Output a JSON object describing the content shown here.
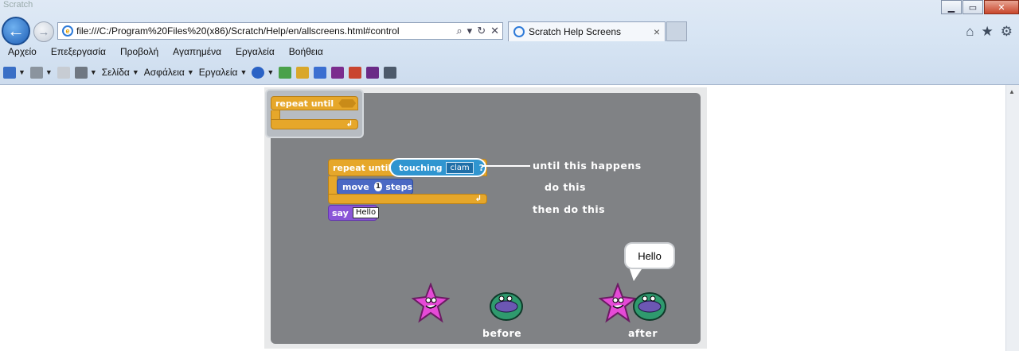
{
  "window": {
    "title_faint": "Scratch",
    "controls": {
      "minimize": "▁",
      "maximize": "▭",
      "close": "✕"
    }
  },
  "address_bar": {
    "url": "file:///C:/Program%20Files%20(x86)/Scratch/Help/en/allscreens.html#control",
    "tools": {
      "search": "⌕",
      "dropdown": "▾",
      "refresh": "↻",
      "stop": "✕"
    }
  },
  "tab": {
    "title": "Scratch Help Screens",
    "close": "×"
  },
  "right_nav": {
    "home": "⌂",
    "favorites": "★",
    "tools": "⚙"
  },
  "menubar": [
    "Αρχείο",
    "Επεξεργασία",
    "Προβολή",
    "Αγαπημένα",
    "Εργαλεία",
    "Βοήθεια"
  ],
  "command_bar": {
    "page": "Σελίδα",
    "safety": "Ασφάλεια",
    "tools": "Εργαλεία"
  },
  "scratch": {
    "palette_block": {
      "label": "repeat until"
    },
    "script": {
      "repeat_label": "repeat until",
      "sensing_label": "touching",
      "sensing_field": "clam",
      "sensing_q": "?",
      "move_label": "move",
      "move_steps": "1",
      "move_unit": "steps",
      "say_label": "say",
      "say_field": "Hello"
    },
    "annotations": {
      "until": "until this happens",
      "do": "do this",
      "then": "then do this"
    },
    "bubble": "Hello",
    "captions": {
      "before": "before",
      "after": "after"
    }
  }
}
